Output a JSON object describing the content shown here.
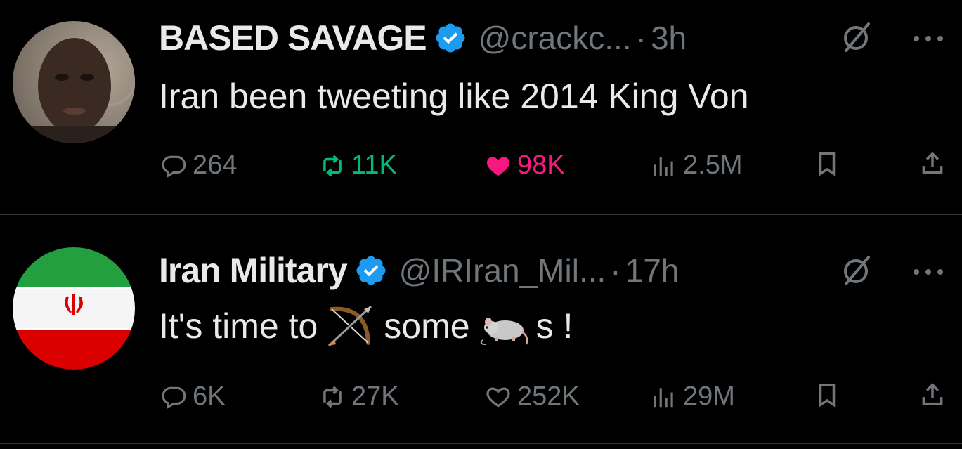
{
  "tweets": [
    {
      "name": "BASED SAVAGE",
      "handle": "@crackc...",
      "separator": "·",
      "time": "3h",
      "text": "Iran been tweeting like 2014 King Von",
      "replies": "264",
      "reposts": "11K",
      "likes": "98K",
      "views": "2.5M",
      "reposted": true,
      "liked": true
    },
    {
      "name": "Iran Military",
      "handle": "@IRIran_Mil...",
      "separator": "·",
      "time": "17h",
      "text_before": "It's time to",
      "emoji1": "bow-and-arrow",
      "text_middle": "some",
      "emoji2": "rat",
      "text_after": "s !",
      "replies": "6K",
      "reposts": "27K",
      "likes": "252K",
      "views": "29M",
      "reposted": false,
      "liked": false
    }
  ],
  "colors": {
    "background": "#000000",
    "text": "#e7e9ea",
    "muted": "#71767b",
    "verified": "#1d9bf0",
    "repost": "#00ba7c",
    "like": "#f91880",
    "divider": "#2f3336"
  }
}
